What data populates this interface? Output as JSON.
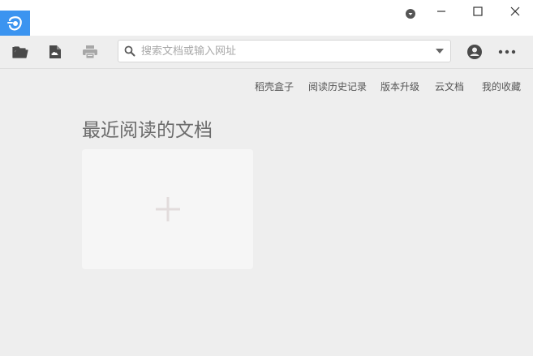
{
  "titlebar": {
    "logo_icon": "foxit-reader-logo-icon",
    "accent_color": "#3b94f0",
    "buttons": [
      "dropdown-menu-icon",
      "minimize-icon",
      "maximize-icon",
      "close-icon"
    ]
  },
  "toolbar": {
    "left_icons": [
      "open-folder-icon",
      "document-icon",
      "print-icon"
    ],
    "right_icons": [
      "user-account-icon",
      "more-options-icon"
    ],
    "search": {
      "placeholder": "搜索文档或输入网址",
      "value": ""
    }
  },
  "nav": {
    "links": [
      "稻壳盒子",
      "阅读历史记录",
      "版本升级",
      "云文档",
      "我的收藏"
    ]
  },
  "recent": {
    "title": "最近阅读的文档",
    "add_card_icon": "plus-icon"
  }
}
